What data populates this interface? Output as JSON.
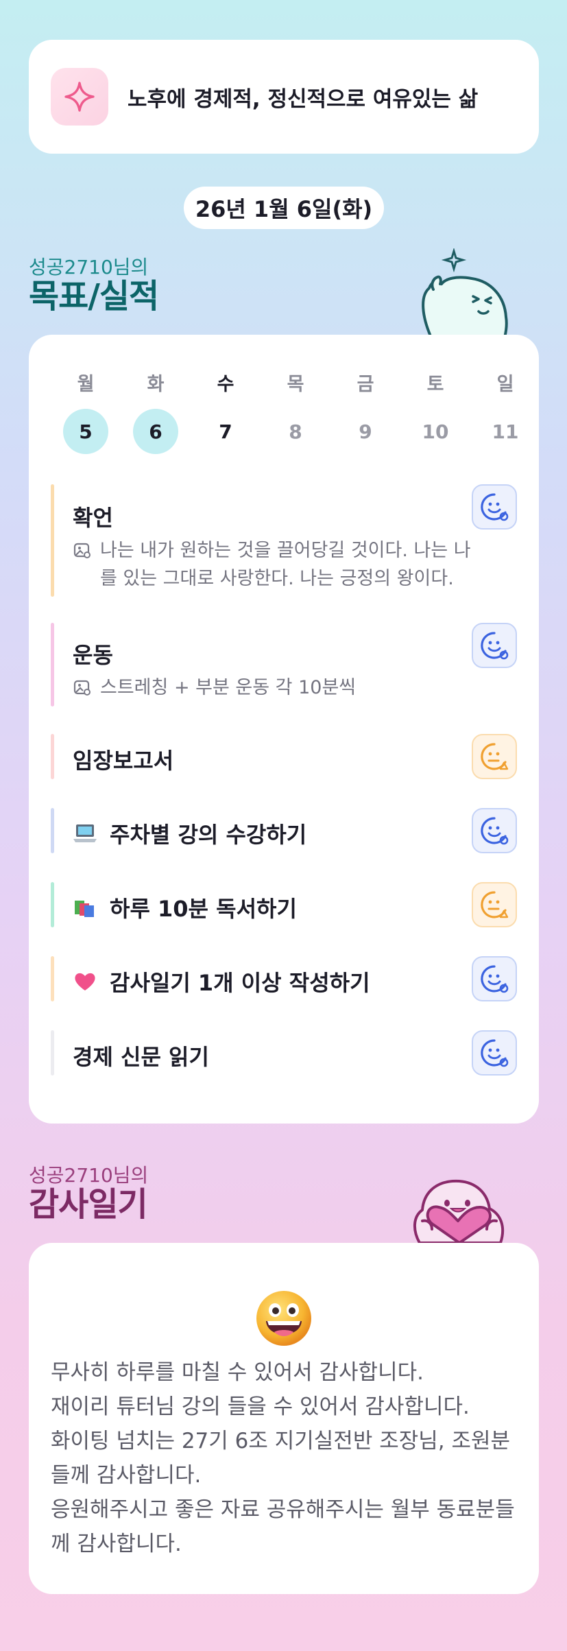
{
  "goal": {
    "text": "노후에 경제적, 정신적으로 여유있는 삶",
    "icon": "sparkle-icon"
  },
  "date": "26년 1월 6일(화)",
  "goals_section": {
    "subtitle": "성공2710님의",
    "title": "목표/실적"
  },
  "week": {
    "days": [
      "월",
      "화",
      "수",
      "목",
      "금",
      "토",
      "일"
    ],
    "dates": [
      "5",
      "6",
      "7",
      "8",
      "9",
      "10",
      "11"
    ],
    "completed_indices": [
      0,
      1
    ],
    "today_index": 2
  },
  "tasks": [
    {
      "title": "확언",
      "emoji": "",
      "description": "나는 내가 원하는 것을 끌어당길 것이다. 나는 나를 있는 그대로 사랑한다. 나는 긍정의 왕이다.",
      "status": "blue-smile",
      "bar_color": "#fbdcae"
    },
    {
      "title": "운동",
      "emoji": "",
      "description": "스트레칭 + 부분 운동 각 10분씩",
      "status": "blue-smile",
      "bar_color": "#f6c6e6"
    },
    {
      "title": "임장보고서",
      "emoji": "",
      "description": "",
      "status": "orange-neutral",
      "bar_color": "#fcd6d6"
    },
    {
      "title": "주차별 강의 수강하기",
      "emoji": "laptop",
      "description": "",
      "status": "blue-smile",
      "bar_color": "#cfd9f4"
    },
    {
      "title": "하루 10분 독서하기",
      "emoji": "books",
      "description": "",
      "status": "orange-neutral",
      "bar_color": "#b3ecd8"
    },
    {
      "title": "감사일기 1개 이상 작성하기",
      "emoji": "heart",
      "description": "",
      "status": "blue-smile",
      "bar_color": "#fde0bc"
    },
    {
      "title": "경제 신문 읽기",
      "emoji": "",
      "description": "",
      "status": "blue-smile",
      "bar_color": "#ececf0"
    }
  ],
  "diary_section": {
    "subtitle": "성공2710님의",
    "title": "감사일기"
  },
  "diary": {
    "emoji": "grinning-face",
    "text": "무사히 하루를 마칠 수 있어서 감사합니다.\n재이리 튜터님 강의 들을 수 있어서 감사합니다.\n화이팅 넘치는 27기 6조 지기실전반 조장님, 조원분들께 감사합니다.\n응원해주시고 좋은 자료 공유해주시는 월부 동료분들께 감사합니다."
  },
  "colors": {
    "blue_status": "#3b63e0",
    "orange_status": "#f0a030",
    "teal_title": "#0c6468",
    "plum_title": "#7c2a64"
  }
}
